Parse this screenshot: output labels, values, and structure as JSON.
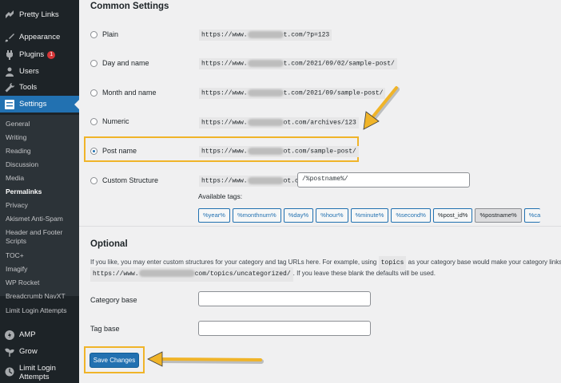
{
  "sidebar": {
    "top_items": [
      {
        "label": "Pretty Links",
        "icon": "pretty-links-icon"
      },
      {
        "label": "Appearance",
        "icon": "paintbrush-icon"
      },
      {
        "label": "Plugins",
        "icon": "plugin-icon",
        "badge": "1"
      },
      {
        "label": "Users",
        "icon": "users-icon"
      },
      {
        "label": "Tools",
        "icon": "wrench-icon"
      },
      {
        "label": "Settings",
        "icon": "settings-icon"
      }
    ],
    "submenu": [
      "General",
      "Writing",
      "Reading",
      "Discussion",
      "Media",
      "Permalinks",
      "Privacy",
      "Akismet Anti-Spam",
      "Header and Footer Scripts",
      "TOC+",
      "Imagify",
      "WP Rocket",
      "Breadcrumb NavXT",
      "Limit Login Attempts"
    ],
    "bottom_items": [
      {
        "label": "AMP",
        "icon": "amp-icon"
      },
      {
        "label": "Grow",
        "icon": "grow-icon"
      },
      {
        "label": "Limit Login Attempts",
        "icon": "limit-login-icon"
      }
    ]
  },
  "common": {
    "heading": "Common Settings",
    "options": [
      {
        "label": "Plain",
        "url_start": "https://www.",
        "url_end": "t.com/?p=123"
      },
      {
        "label": "Day and name",
        "url_start": "https://www.",
        "url_end": "t.com/2021/09/02/sample-post/"
      },
      {
        "label": "Month and name",
        "url_start": "https://www.",
        "url_end": "t.com/2021/09/sample-post/"
      },
      {
        "label": "Numeric",
        "url_start": "https://www.",
        "url_end": "ot.com/archives/123"
      },
      {
        "label": "Post name",
        "url_start": "https://www.",
        "url_end": "ot.com/sample-post/"
      },
      {
        "label": "Custom Structure",
        "url_start": "https://www.",
        "url_end": "ot.com"
      }
    ],
    "selected": "Post name",
    "custom_structure_value": "/%postname%/",
    "available_tags_label": "Available tags:",
    "tags": [
      "%year%",
      "%monthnum%",
      "%day%",
      "%hour%",
      "%minute%",
      "%second%",
      "%post_id%",
      "%postname%",
      "%ca"
    ]
  },
  "optional": {
    "heading": "Optional",
    "desc_line1_a": "If you like, you may enter custom structures for your category and tag URLs here. For example, using",
    "desc_code1": "topics",
    "desc_line1_b": "as your category base would make your category links li",
    "desc_code2_start": "https://www.",
    "desc_code2_end": "com/topics/uncategorized/",
    "desc_line2_b": ". If you leave these blank the defaults will be used.",
    "category_base_label": "Category base",
    "tag_base_label": "Tag base",
    "category_base_value": "",
    "tag_base_value": ""
  },
  "save_button": "Save Changes",
  "colors": {
    "accent": "#2271b1",
    "highlight": "#f0b429",
    "sidebar": "#1d2327"
  }
}
